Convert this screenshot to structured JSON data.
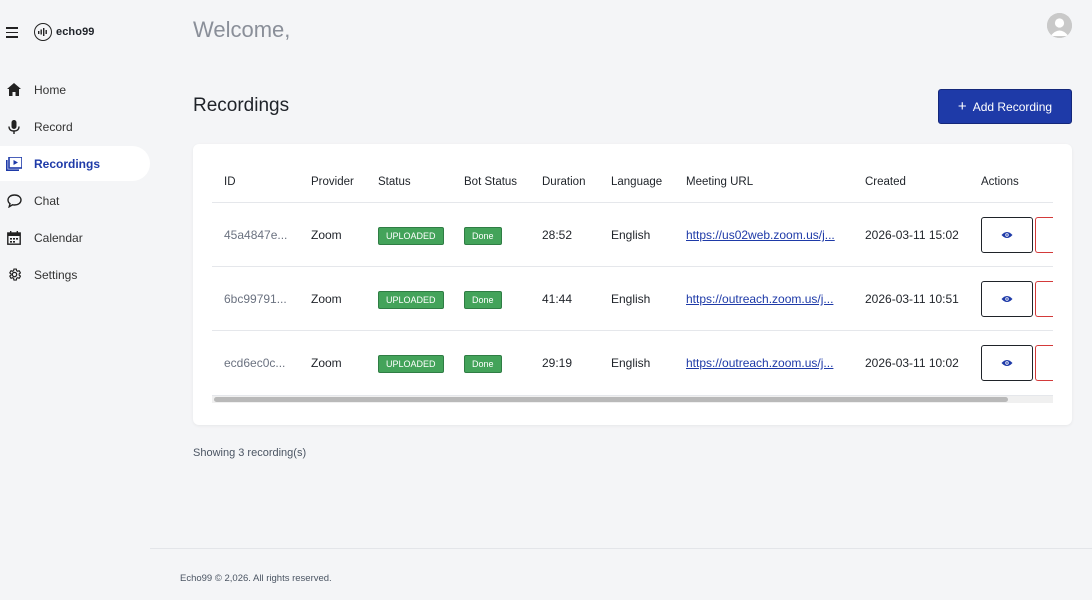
{
  "brand": {
    "name": "echo99"
  },
  "nav": [
    {
      "label": "Home",
      "icon": "home-icon"
    },
    {
      "label": "Record",
      "icon": "microphone-icon"
    },
    {
      "label": "Recordings",
      "icon": "video-library-icon",
      "active": true
    },
    {
      "label": "Chat",
      "icon": "chat-bubble-icon"
    },
    {
      "label": "Calendar",
      "icon": "calendar-icon"
    },
    {
      "label": "Settings",
      "icon": "gear-icon"
    }
  ],
  "header": {
    "welcome": "Welcome,"
  },
  "recordings": {
    "title": "Recordings",
    "add_label": "Add Recording",
    "columns": [
      "ID",
      "Provider",
      "Status",
      "Bot Status",
      "Duration",
      "Language",
      "Meeting URL",
      "Created",
      "Actions"
    ],
    "rows": [
      {
        "id": "45a4847e...",
        "provider": "Zoom",
        "status": "UPLOADED",
        "bot_status": "Done",
        "duration": "28:52",
        "language": "English",
        "url": "https://us02web.zoom.us/j...",
        "created": "2026-03-11 15:02"
      },
      {
        "id": "6bc99791...",
        "provider": "Zoom",
        "status": "UPLOADED",
        "bot_status": "Done",
        "duration": "41:44",
        "language": "English",
        "url": "https://outreach.zoom.us/j...",
        "created": "2026-03-11 10:51"
      },
      {
        "id": "ecd6ec0c...",
        "provider": "Zoom",
        "status": "UPLOADED",
        "bot_status": "Done",
        "duration": "29:19",
        "language": "English",
        "url": "https://outreach.zoom.us/j...",
        "created": "2026-03-11 10:02"
      }
    ],
    "count_text": "Showing 3 recording(s)"
  },
  "footer": {
    "text": "Echo99 © 2,026. All rights reserved."
  },
  "colors": {
    "primary": "#1e3aa8",
    "success": "#43a35a",
    "danger": "#d33a3a",
    "background": "#f4f5f7"
  }
}
